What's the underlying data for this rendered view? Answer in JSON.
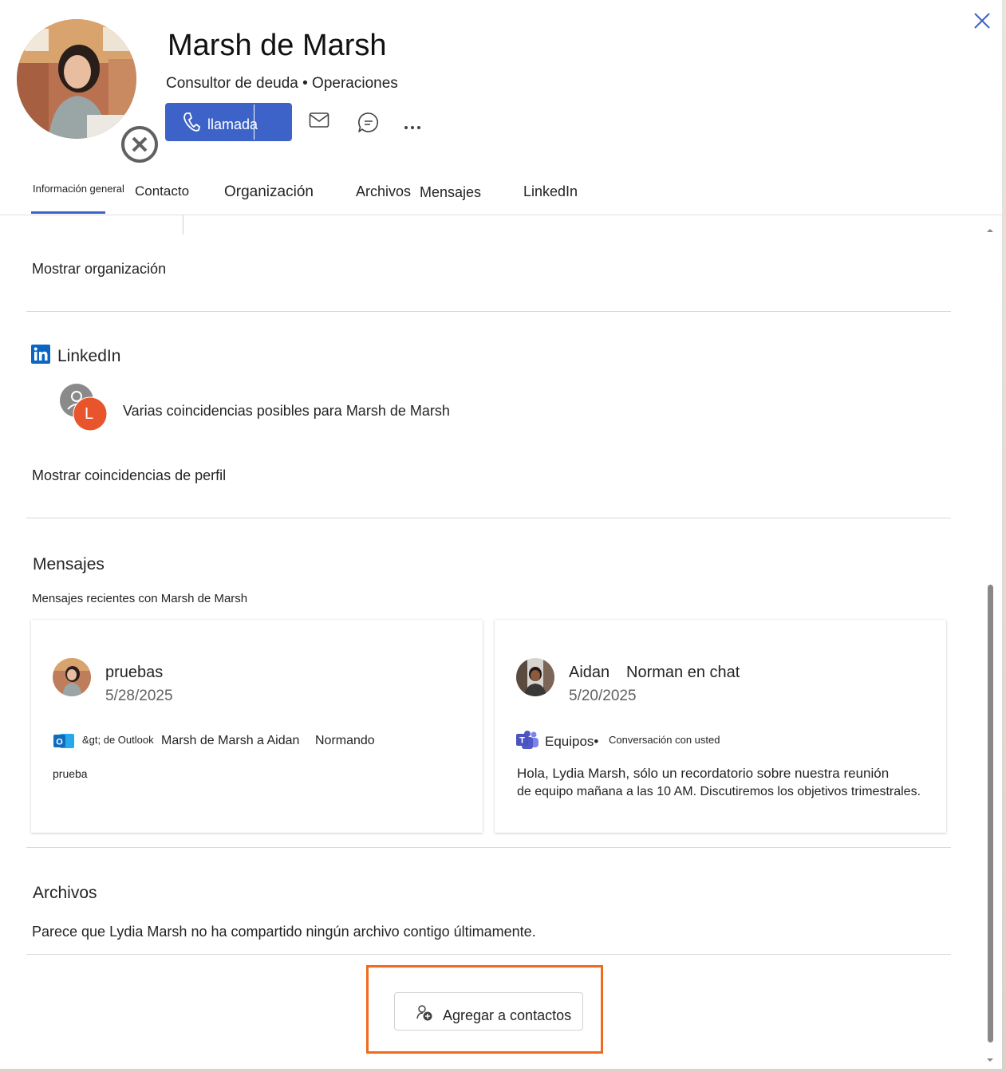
{
  "profile": {
    "name": "Marsh de Marsh",
    "subtitle": "Consultor de deuda • Operaciones",
    "call_label": "llamada"
  },
  "icons": {
    "close": "close-icon",
    "phone": "phone-icon",
    "mail": "mail-icon",
    "chat": "chat-icon",
    "more": "more-icon",
    "presence": "presence-offline-icon",
    "linkedin": "linkedin-icon",
    "outlook": "outlook-icon",
    "teams": "teams-icon",
    "add_contact": "add-contact-icon"
  },
  "tabs": [
    {
      "label": "Información general",
      "active": true
    },
    {
      "label": "Contacto"
    },
    {
      "label": "Organización"
    },
    {
      "label": "Archivos"
    },
    {
      "label": "Mensajes"
    },
    {
      "label": "LinkedIn"
    }
  ],
  "organization": {
    "show_label": "Mostrar organización"
  },
  "linkedin": {
    "title": "LinkedIn",
    "match_text": "Varias coincidencias posibles para Marsh de Marsh",
    "avatar_letter": "L",
    "show_matches": "Mostrar coincidencias de perfil"
  },
  "messages": {
    "title": "Mensajes",
    "subtitle": "Mensajes recientes con Marsh de Marsh",
    "cards": [
      {
        "title": "pruebas",
        "date": "5/28/2025",
        "source": "&gt; de Outlook",
        "route": "Marsh de Marsh a Aidan",
        "route_extra": "Normando",
        "body": "prueba"
      },
      {
        "title": "Aidan",
        "title_extra": "Norman en chat",
        "date": "5/20/2025",
        "source": "Equipos•",
        "route": "Conversación con usted",
        "body_line1": "Hola, Lydia Marsh, sólo un recordatorio sobre nuestra reunión",
        "body_line2": "de equipo mañana a las 10 AM. Discutiremos los objetivos trimestrales."
      }
    ]
  },
  "files": {
    "title": "Archivos",
    "empty_text": "Parece que Lydia Marsh no ha compartido ningún archivo contigo últimamente."
  },
  "add_contact": {
    "label": "Agregar a contactos"
  },
  "colors": {
    "accent": "#3d63c8",
    "highlight": "#f26a1b",
    "linkedin_orange": "#e8552c",
    "linkedin_blue": "#0a66c2"
  }
}
